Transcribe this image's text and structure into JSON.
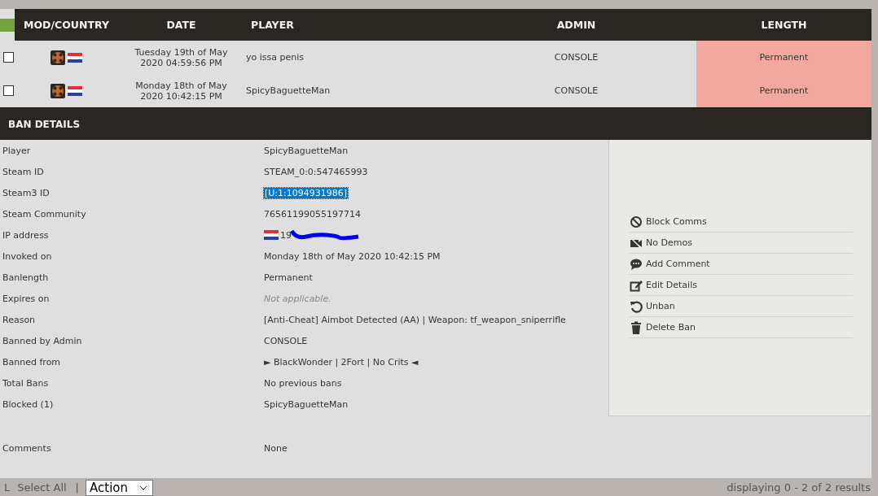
{
  "table": {
    "columns": [
      "MOD/COUNTRY",
      "DATE",
      "PLAYER",
      "ADMIN",
      "LENGTH"
    ],
    "rows": [
      {
        "checked": false,
        "date": "Tuesday 19th of May 2020 04:59:56 PM",
        "player": "yo issa penis",
        "admin": "CONSOLE",
        "length": "Permanent"
      },
      {
        "checked": false,
        "date": "Monday 18th of May 2020 10:42:15 PM",
        "player": "SpicyBaguetteMan",
        "admin": "CONSOLE",
        "length": "Permanent"
      }
    ]
  },
  "ban_details": {
    "title": "BAN DETAILS",
    "fields": [
      {
        "label": "Player",
        "value": "SpicyBaguetteMan",
        "kind": "text"
      },
      {
        "label": "Steam ID",
        "value": "STEAM_0:0:547465993",
        "kind": "text"
      },
      {
        "label": "Steam3 ID",
        "value": "[U:1:1094931986]",
        "kind": "selected"
      },
      {
        "label": "Steam Community",
        "value": "76561199055197714",
        "kind": "text"
      },
      {
        "label": "IP address",
        "value": "19",
        "kind": "ip"
      },
      {
        "label": "Invoked on",
        "value": "Monday 18th of May 2020 10:42:15 PM",
        "kind": "text"
      },
      {
        "label": "Banlength",
        "value": "Permanent",
        "kind": "text"
      },
      {
        "label": "Expires on",
        "value": "Not applicable.",
        "kind": "muted"
      },
      {
        "label": "Reason",
        "value": "[Anti-Cheat] Aimbot Detected (AA) | Weapon: tf_weapon_sniperrifle",
        "kind": "text"
      },
      {
        "label": "Banned by Admin",
        "value": "CONSOLE",
        "kind": "text"
      },
      {
        "label": "Banned from",
        "value": "► BlackWonder | 2Fort | No Crits ◄",
        "kind": "text"
      },
      {
        "label": "Total Bans",
        "value": "No previous bans",
        "kind": "text"
      },
      {
        "label": "Blocked (1)",
        "value": "SpicyBaguetteMan",
        "kind": "text"
      }
    ],
    "comments": {
      "label": "Comments",
      "value": "None"
    },
    "actions": [
      {
        "label": "Block Comms",
        "kind": "block"
      },
      {
        "label": "No Demos",
        "kind": "novideo"
      },
      {
        "label": "Add Comment",
        "kind": "comment"
      },
      {
        "label": "Edit Details",
        "kind": "edit"
      },
      {
        "label": "Unban",
        "kind": "undo"
      },
      {
        "label": "Delete Ban",
        "kind": "trash"
      }
    ]
  },
  "footer": {
    "marker": "L",
    "select_all": "Select All",
    "separator": "|",
    "action": "Action",
    "results": "displaying 0 - 2 of 2 results"
  }
}
